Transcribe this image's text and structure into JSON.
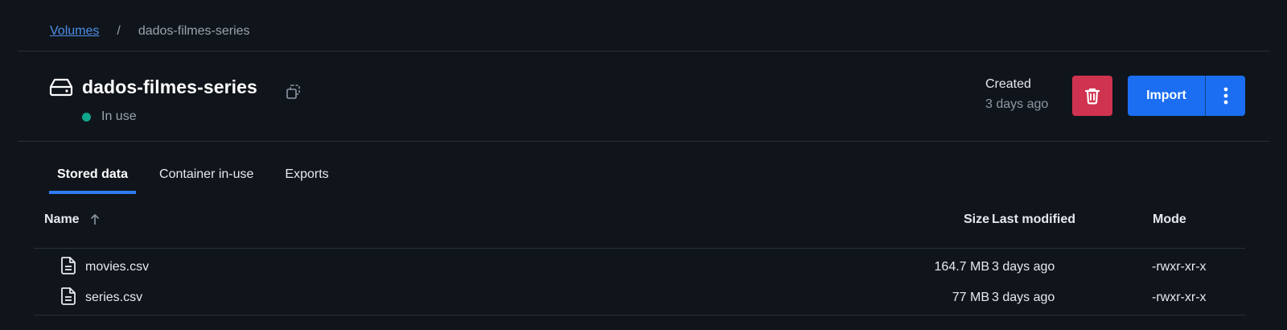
{
  "breadcrumb": {
    "parent": "Volumes",
    "separator": "/",
    "current": "dados-filmes-series"
  },
  "header": {
    "title": "dados-filmes-series",
    "status": "In use",
    "status_color": "#11a68c",
    "created_label": "Created",
    "created_value": "3 days ago",
    "delete_icon": "trash-icon",
    "import_label": "Import",
    "more_icon": "kebab-menu-icon",
    "accent_color": "#1b6ef2",
    "danger_color": "#d0334f"
  },
  "tabs": [
    {
      "label": "Stored data",
      "active": true
    },
    {
      "label": "Container in-use",
      "active": false
    },
    {
      "label": "Exports",
      "active": false
    }
  ],
  "table": {
    "columns": {
      "name": "Name",
      "size": "Size",
      "modified": "Last modified",
      "mode": "Mode"
    },
    "sort": {
      "column": "Name",
      "direction": "ascending"
    },
    "rows": [
      {
        "name": "movies.csv",
        "size": "164.7 MB",
        "modified": "3 days ago",
        "mode": "-rwxr-xr-x"
      },
      {
        "name": "series.csv",
        "size": "77 MB",
        "modified": "3 days ago",
        "mode": "-rwxr-xr-x"
      }
    ]
  }
}
